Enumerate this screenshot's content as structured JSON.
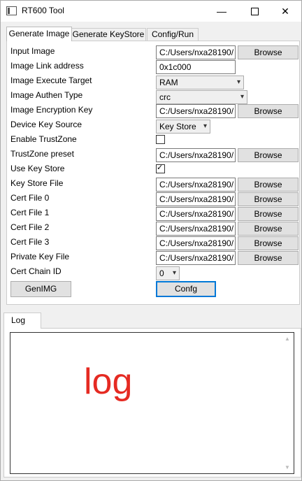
{
  "window": {
    "title": "RT600 Tool",
    "min_glyph": "—",
    "close_glyph": "✕"
  },
  "tabs": [
    {
      "label": "Generate Image",
      "active": true
    },
    {
      "label": "Generate KeyStore",
      "active": false
    },
    {
      "label": "Config/Run",
      "active": false
    }
  ],
  "form": {
    "input_image": {
      "label": "Input Image",
      "value": "C:/Users/nxa28190/",
      "button": "Browse"
    },
    "image_link_address": {
      "label": "Image Link address",
      "value": "0x1c000"
    },
    "image_execute_target": {
      "label": "Image Execute Target",
      "value": "RAM"
    },
    "image_authen_type": {
      "label": "Image Authen Type",
      "value": "crc"
    },
    "image_encryption_key": {
      "label": "Image Encryption Key",
      "value": "C:/Users/nxa28190/",
      "button": "Browse"
    },
    "device_key_source": {
      "label": "Device Key Source",
      "value": "Key Store"
    },
    "enable_trustzone": {
      "label": "Enable TrustZone",
      "checked": false
    },
    "trustzone_preset": {
      "label": "TrustZone preset",
      "value": "C:/Users/nxa28190/",
      "button": "Browse"
    },
    "use_key_store": {
      "label": "Use Key Store",
      "checked": true,
      "mark": "✓"
    },
    "key_store_file": {
      "label": "Key Store File",
      "value": "C:/Users/nxa28190/",
      "button": "Browse"
    },
    "cert_file_0": {
      "label": "Cert File 0",
      "value": "C:/Users/nxa28190/",
      "button": "Browse"
    },
    "cert_file_1": {
      "label": "Cert File 1",
      "value": "C:/Users/nxa28190/",
      "button": "Browse"
    },
    "cert_file_2": {
      "label": "Cert File 2",
      "value": "C:/Users/nxa28190/",
      "button": "Browse"
    },
    "cert_file_3": {
      "label": "Cert File 3",
      "value": "C:/Users/nxa28190/",
      "button": "Browse"
    },
    "private_key_file": {
      "label": "Private Key File",
      "value": "C:/Users/nxa28190/",
      "button": "Browse"
    },
    "cert_chain_id": {
      "label": "Cert Chain ID",
      "value": "0"
    }
  },
  "actions": {
    "genimg": "GenIMG",
    "config": "Confg"
  },
  "log": {
    "tab_label": "Log",
    "content": "log",
    "content_color": "#e52a22"
  }
}
